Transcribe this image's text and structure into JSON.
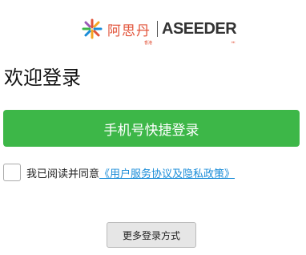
{
  "logo": {
    "brand_cn": "阿思丹",
    "brand_cn_small": "香港",
    "brand_en": "ASEEDER",
    "brand_en_sub": "HK",
    "brand_color": "#e2543a"
  },
  "page_title": "欢迎登录",
  "login_button": {
    "label": "手机号快捷登录",
    "color": "#3db748"
  },
  "agreement": {
    "checked": false,
    "prefix": "我已阅读并同意",
    "link_text": "《用户服务协议及隐私政策》",
    "link_color": "#1a8cd8"
  },
  "more_login": {
    "label": "更多登录方式"
  }
}
